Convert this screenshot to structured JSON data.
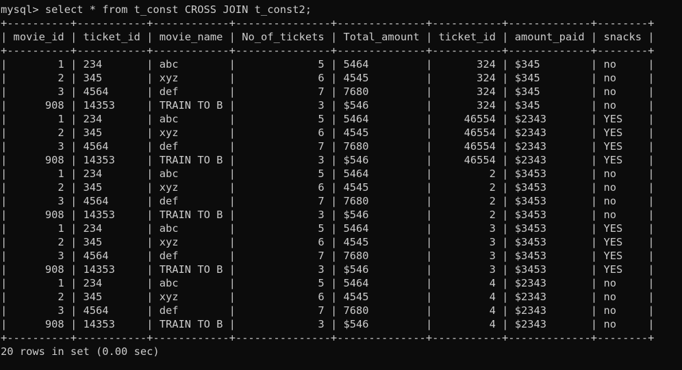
{
  "prompt": "mysql>",
  "command": "select * from t_const CROSS JOIN t_const2;",
  "table": {
    "columns": [
      {
        "header": "movie_id",
        "align": "right"
      },
      {
        "header": "ticket_id",
        "align": "left"
      },
      {
        "header": "movie_name",
        "align": "left"
      },
      {
        "header": "No_of_tickets",
        "align": "right"
      },
      {
        "header": "Total_amount",
        "align": "left"
      },
      {
        "header": "ticket_id",
        "align": "right"
      },
      {
        "header": "amount_paid",
        "align": "left"
      },
      {
        "header": "snacks",
        "align": "left"
      }
    ],
    "rows": [
      [
        "1",
        "234",
        "abc",
        "5",
        "5464",
        "324",
        "$345",
        "no"
      ],
      [
        "2",
        "345",
        "xyz",
        "6",
        "4545",
        "324",
        "$345",
        "no"
      ],
      [
        "3",
        "4564",
        "def",
        "7",
        "7680",
        "324",
        "$345",
        "no"
      ],
      [
        "908",
        "14353",
        "TRAIN TO B",
        "3",
        "$546",
        "324",
        "$345",
        "no"
      ],
      [
        "1",
        "234",
        "abc",
        "5",
        "5464",
        "46554",
        "$2343",
        "YES"
      ],
      [
        "2",
        "345",
        "xyz",
        "6",
        "4545",
        "46554",
        "$2343",
        "YES"
      ],
      [
        "3",
        "4564",
        "def",
        "7",
        "7680",
        "46554",
        "$2343",
        "YES"
      ],
      [
        "908",
        "14353",
        "TRAIN TO B",
        "3",
        "$546",
        "46554",
        "$2343",
        "YES"
      ],
      [
        "1",
        "234",
        "abc",
        "5",
        "5464",
        "2",
        "$3453",
        "no"
      ],
      [
        "2",
        "345",
        "xyz",
        "6",
        "4545",
        "2",
        "$3453",
        "no"
      ],
      [
        "3",
        "4564",
        "def",
        "7",
        "7680",
        "2",
        "$3453",
        "no"
      ],
      [
        "908",
        "14353",
        "TRAIN TO B",
        "3",
        "$546",
        "2",
        "$3453",
        "no"
      ],
      [
        "1",
        "234",
        "abc",
        "5",
        "5464",
        "3",
        "$3453",
        "YES"
      ],
      [
        "2",
        "345",
        "xyz",
        "6",
        "4545",
        "3",
        "$3453",
        "YES"
      ],
      [
        "3",
        "4564",
        "def",
        "7",
        "7680",
        "3",
        "$3453",
        "YES"
      ],
      [
        "908",
        "14353",
        "TRAIN TO B",
        "3",
        "$546",
        "3",
        "$3453",
        "YES"
      ],
      [
        "1",
        "234",
        "abc",
        "5",
        "5464",
        "4",
        "$2343",
        "no"
      ],
      [
        "2",
        "345",
        "xyz",
        "6",
        "4545",
        "4",
        "$2343",
        "no"
      ],
      [
        "3",
        "4564",
        "def",
        "7",
        "7680",
        "4",
        "$2343",
        "no"
      ],
      [
        "908",
        "14353",
        "TRAIN TO B",
        "3",
        "$546",
        "4",
        "$2343",
        "no"
      ]
    ]
  },
  "result_summary": "20 rows in set (0.00 sec)",
  "colors": {
    "background": "#0c0c0c",
    "text": "#cccccc"
  }
}
